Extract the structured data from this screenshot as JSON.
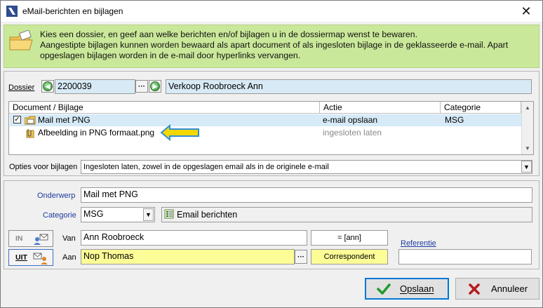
{
  "window": {
    "title": "eMail-berichten en bijlagen"
  },
  "info": {
    "lines": [
      "Kies een dossier, en geef aan welke berichten en/of bijlagen u in de dossiermap wenst te bewaren.",
      "Aangestipte bijlagen kunnen worden bewaard als apart document of als ingesloten bijlage in de geklasseerde e-mail. Apart",
      "opgeslagen bijlagen worden in de e-mail door hyperlinks vervangen."
    ]
  },
  "dossier": {
    "label": "Dossier",
    "number": "2200039",
    "name": "Verkoop Roobroeck Ann"
  },
  "grid": {
    "columns": [
      "Document / Bijlage",
      "Actie",
      "Categorie"
    ],
    "rows": [
      {
        "document": "Mail met PNG",
        "actie": "e-mail opslaan",
        "categorie": "MSG",
        "checked": true
      },
      {
        "document": "Afbeelding in PNG formaat.png",
        "actie": "ingesloten laten",
        "categorie": ""
      }
    ]
  },
  "opties": {
    "label": "Opties voor bijlagen",
    "value": "Ingesloten laten, zowel in de opgeslagen email als in de originele e-mail"
  },
  "onderwerp": {
    "label": "Onderwerp",
    "value": "Mail met PNG"
  },
  "categorie": {
    "label": "Categorie",
    "value": "MSG",
    "description": "Email berichten"
  },
  "direction": {
    "in_label": "IN",
    "uit_label": "UIT"
  },
  "van": {
    "label": "Van",
    "value": "Ann Roobroeck",
    "code": "= [ann]"
  },
  "aan": {
    "label": "Aan",
    "value": "Nop Thomas",
    "role": "Correspondent"
  },
  "referentie": {
    "label": "Referentie",
    "value": ""
  },
  "buttons": {
    "save": "Opslaan",
    "cancel": "Annuleer"
  },
  "colors": {
    "info_bg": "#c9e899",
    "highlight": "#fdfd97",
    "selection": "#d6eaf7",
    "arrow": "#f5d800"
  }
}
